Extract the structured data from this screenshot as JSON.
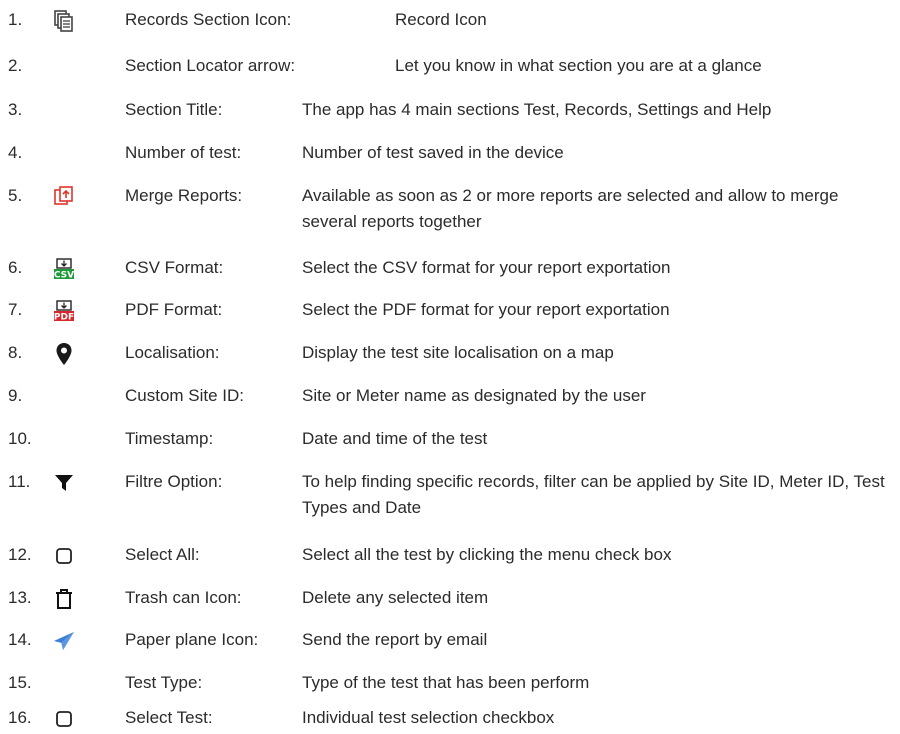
{
  "colors": {
    "text": "#2b2b2b",
    "merge_red": "#e0352b",
    "csv_green": "#1f9a3a",
    "pdf_red": "#d8262c",
    "paper_plane_blue": "#3d7fd6",
    "icon_dark": "#222222"
  },
  "items": [
    {
      "num": "1.",
      "icon": "records-section-icon",
      "term": "Records Section Icon:",
      "desc": "Record Icon"
    },
    {
      "num": "2.",
      "icon": "",
      "term": "Section Locator arrow:",
      "desc": "Let you know in what section you are at a glance"
    },
    {
      "num": "3.",
      "icon": "",
      "term": "Section Title:",
      "desc": "The app has 4 main sections Test, Records, Settings and Help"
    },
    {
      "num": "4.",
      "icon": "",
      "term": "Number of test:",
      "desc": "Number of test saved in the device"
    },
    {
      "num": "5.",
      "icon": "merge-reports-icon",
      "term": "Merge Reports:",
      "desc": "Available as soon as 2 or more reports are selected and allow to merge several reports together"
    },
    {
      "num": "6.",
      "icon": "csv-format-icon",
      "icon_text": "CSV",
      "term": "CSV Format:",
      "desc": "Select the CSV format for your report exportation"
    },
    {
      "num": "7.",
      "icon": "pdf-format-icon",
      "icon_text": "PDF",
      "term": "PDF Format:",
      "desc": "Select the PDF format for your report exportation"
    },
    {
      "num": "8.",
      "icon": "map-pin-icon",
      "term": "Localisation:",
      "desc": "Display the test site localisation on a map"
    },
    {
      "num": "9.",
      "icon": "",
      "term": "Custom Site ID:",
      "desc": "Site or Meter name as designated by the user"
    },
    {
      "num": "10.",
      "icon": "",
      "term": "Timestamp:",
      "desc": "Date and time of the test"
    },
    {
      "num": "11.",
      "icon": "filter-icon",
      "term": "Filtre Option:",
      "desc": "To help finding specific records, filter can be applied by Site ID, Meter ID, Test Types and Date"
    },
    {
      "num": "12.",
      "icon": "checkbox-icon",
      "term": "Select All:",
      "desc": "Select all the test by clicking the menu check box"
    },
    {
      "num": "13.",
      "icon": "trash-can-icon",
      "term": "Trash can Icon:",
      "desc": "Delete any selected item"
    },
    {
      "num": "14.",
      "icon": "paper-plane-icon",
      "term": "Paper plane Icon:",
      "desc": "Send the report by email"
    },
    {
      "num": "15.",
      "icon": "",
      "term": "Test Type:",
      "desc": "Type of the test that has been perform"
    },
    {
      "num": "16.",
      "icon": "checkbox-icon",
      "term": "Select Test:",
      "desc": "Individual test selection checkbox"
    }
  ]
}
